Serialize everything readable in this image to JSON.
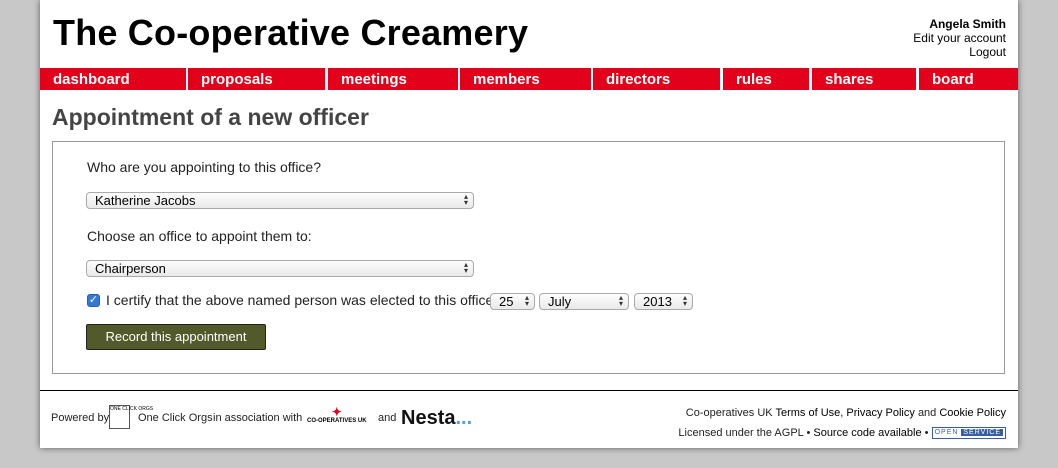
{
  "site": {
    "title": "The Co-operative Creamery"
  },
  "user": {
    "name": "Angela Smith",
    "edit_account": "Edit your account",
    "logout": "Logout"
  },
  "nav": [
    "dashboard",
    "proposals",
    "meetings",
    "members",
    "directors",
    "rules",
    "shares",
    "board"
  ],
  "page": {
    "heading": "Appointment of a new officer"
  },
  "form": {
    "who_question": "Who are you appointing to this office?",
    "person_selected": "Katherine Jacobs",
    "office_question": "Choose an office to appoint them to:",
    "office_selected": "Chairperson",
    "certify_checked": true,
    "certify_text": "I certify that the above named person was elected to this office on",
    "day": "25",
    "month": "July",
    "year": "2013",
    "submit_label": "Record this appointment"
  },
  "footer": {
    "powered_by": "Powered by",
    "oco_logo_text": "ONE CLICK ORGS",
    "oco_name": "One Click Orgs",
    "in_association": "in association with",
    "coop_logo_text": "CO-OPERATIVES UK",
    "and_text": "and",
    "nesta": "Nesta",
    "nesta_dots": "...",
    "coops_uk": "Co-operatives UK",
    "terms": "Terms of Use",
    "privacy": "Privacy Policy",
    "and2": "and",
    "cookie": "Cookie Policy",
    "licensed": "Licensed under the AGPL",
    "source": "Source code available",
    "bullet": "•",
    "open": "OPEN",
    "service": "SERVICE"
  }
}
